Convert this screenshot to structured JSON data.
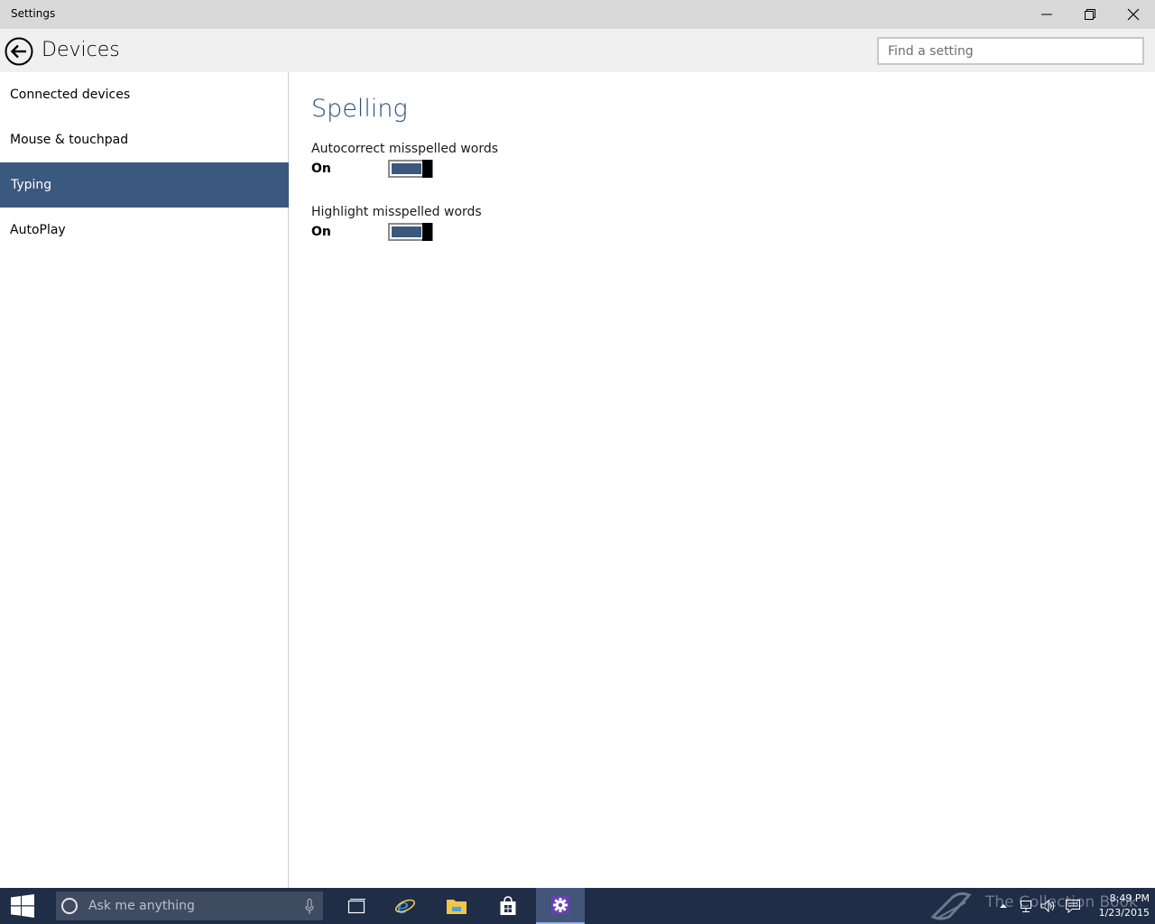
{
  "window": {
    "title": "Settings"
  },
  "header": {
    "title": "Devices",
    "search_placeholder": "Find a setting"
  },
  "sidebar": {
    "items": [
      {
        "label": "Connected devices",
        "active": false
      },
      {
        "label": "Mouse & touchpad",
        "active": false
      },
      {
        "label": "Typing",
        "active": true
      },
      {
        "label": "AutoPlay",
        "active": false
      }
    ]
  },
  "content": {
    "section_title": "Spelling",
    "settings": [
      {
        "label": "Autocorrect misspelled words",
        "state": "On"
      },
      {
        "label": "Highlight misspelled words",
        "state": "On"
      }
    ]
  },
  "taskbar": {
    "search_placeholder": "Ask me anything",
    "watermark": "The Collection Book",
    "time": "8:49 PM",
    "date": "1/23/2015"
  },
  "colors": {
    "accent": "#3b587e",
    "section_title": "#2b4e7a",
    "taskbar": "#1f2d46"
  },
  "icons": {
    "back": "back-arrow-icon",
    "minimize": "minimize-icon",
    "maximize": "restore-icon",
    "close": "close-icon"
  }
}
